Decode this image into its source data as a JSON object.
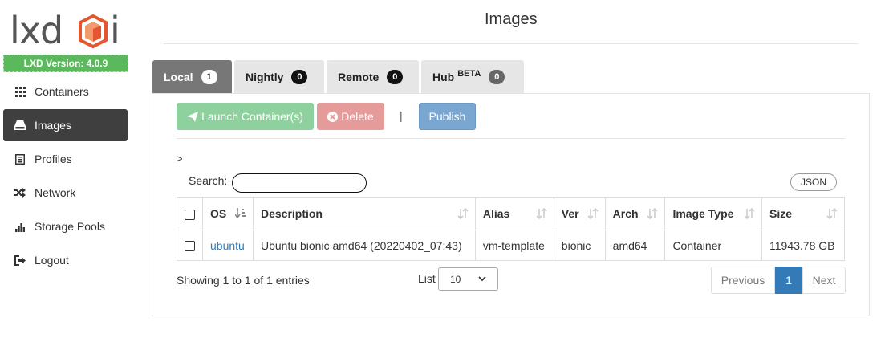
{
  "app": {
    "logo_text": "lxdui",
    "version_label": "LXD Version: 4.0.9"
  },
  "sidebar": {
    "items": [
      {
        "label": "Containers",
        "icon": "grid-icon"
      },
      {
        "label": "Images",
        "icon": "hdd-icon",
        "active": true
      },
      {
        "label": "Profiles",
        "icon": "list-icon"
      },
      {
        "label": "Network",
        "icon": "shuffle-icon"
      },
      {
        "label": "Storage Pools",
        "icon": "bars-icon"
      },
      {
        "label": "Logout",
        "icon": "sign-out-icon"
      }
    ]
  },
  "page": {
    "title": "Images"
  },
  "tabs": [
    {
      "label": "Local",
      "count": "1",
      "active": true
    },
    {
      "label": "Nightly",
      "count": "0"
    },
    {
      "label": "Remote",
      "count": "0"
    },
    {
      "label": "Hub",
      "sup": "BETA",
      "count": "0"
    }
  ],
  "toolbar": {
    "launch_label": "Launch Container(s)",
    "delete_label": "Delete",
    "separator": "|",
    "publish_label": "Publish"
  },
  "breadcrumb": ">",
  "search": {
    "label": "Search:",
    "value": ""
  },
  "json_button": "JSON",
  "table": {
    "columns": [
      "OS",
      "Description",
      "Alias",
      "Ver",
      "Arch",
      "Image Type",
      "Size"
    ],
    "rows": [
      {
        "os": "ubuntu",
        "description": "Ubuntu bionic amd64 (20220402_07:43)",
        "alias": "vm-template",
        "ver": "bionic",
        "arch": "amd64",
        "type": "Container",
        "size": "11943.78 GB"
      }
    ]
  },
  "footer": {
    "info": "Showing 1 to 1 of 1 entries",
    "list_label": "List",
    "list_value": "10",
    "prev": "Previous",
    "current_page": "1",
    "next": "Next"
  },
  "colors": {
    "version_bg": "#5cb85c",
    "active_nav_bg": "#3f3f3f",
    "launch_bg": "#8fd19e",
    "delete_bg": "#e59b9a",
    "publish_bg": "#7aa7d1",
    "link": "#337ab7",
    "logo_orange": "#e4572e"
  }
}
